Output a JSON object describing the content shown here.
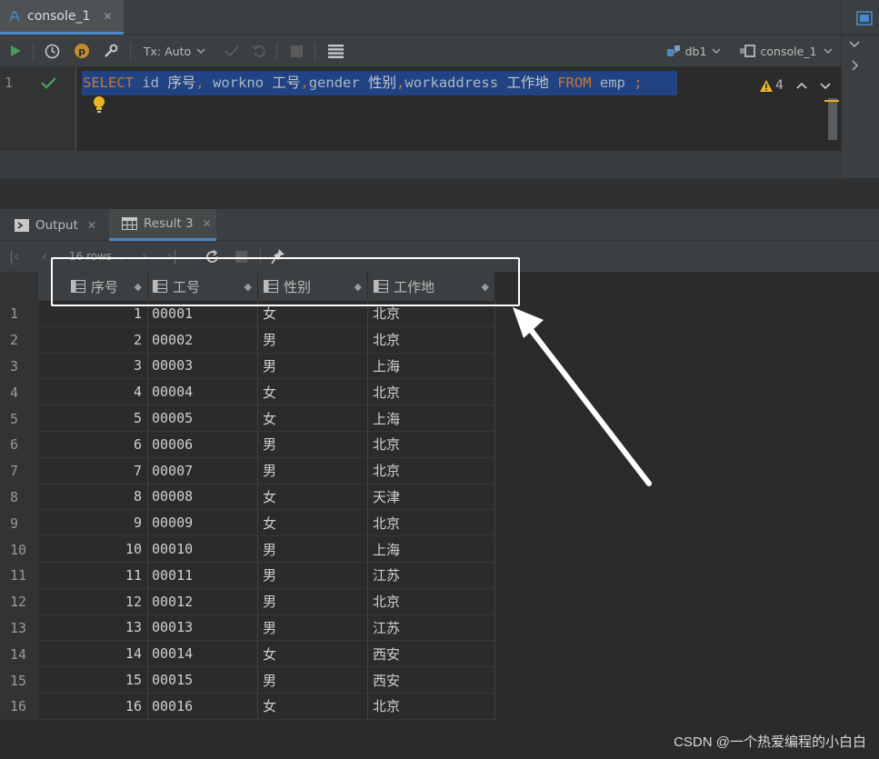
{
  "editor_tab": {
    "label": "console_1",
    "close": "✕"
  },
  "toolbar": {
    "tx_mode": "Tx: Auto",
    "datasource": "db1",
    "session": "console_1"
  },
  "editor": {
    "line_number": "1",
    "sql": {
      "select": "SELECT",
      "col1": " id ",
      "alias1": "序号",
      "comma1": ", ",
      "col2": "workno ",
      "alias2": "工号",
      "comma2": ",",
      "col3": "gender ",
      "alias3": "性别",
      "comma3": ",",
      "col4": "workaddress ",
      "alias4": "工作地",
      "from": " FROM ",
      "table": "emp ",
      "semi": ";"
    },
    "warnings_count": "4"
  },
  "panel_tabs": [
    {
      "label": "Output"
    },
    {
      "label": "Result 3"
    }
  ],
  "result_toolbar": {
    "rows_label": "16 rows"
  },
  "columns": [
    "序号",
    "工号",
    "性别",
    "工作地"
  ],
  "rows": [
    {
      "n": "1",
      "id": "1",
      "workno": "00001",
      "gender": "女",
      "addr": "北京"
    },
    {
      "n": "2",
      "id": "2",
      "workno": "00002",
      "gender": "男",
      "addr": "北京"
    },
    {
      "n": "3",
      "id": "3",
      "workno": "00003",
      "gender": "男",
      "addr": "上海"
    },
    {
      "n": "4",
      "id": "4",
      "workno": "00004",
      "gender": "女",
      "addr": "北京"
    },
    {
      "n": "5",
      "id": "5",
      "workno": "00005",
      "gender": "女",
      "addr": "上海"
    },
    {
      "n": "6",
      "id": "6",
      "workno": "00006",
      "gender": "男",
      "addr": "北京"
    },
    {
      "n": "7",
      "id": "7",
      "workno": "00007",
      "gender": "男",
      "addr": "北京"
    },
    {
      "n": "8",
      "id": "8",
      "workno": "00008",
      "gender": "女",
      "addr": "天津"
    },
    {
      "n": "9",
      "id": "9",
      "workno": "00009",
      "gender": "女",
      "addr": "北京"
    },
    {
      "n": "10",
      "id": "10",
      "workno": "00010",
      "gender": "男",
      "addr": "上海"
    },
    {
      "n": "11",
      "id": "11",
      "workno": "00011",
      "gender": "男",
      "addr": "江苏"
    },
    {
      "n": "12",
      "id": "12",
      "workno": "00012",
      "gender": "男",
      "addr": "北京"
    },
    {
      "n": "13",
      "id": "13",
      "workno": "00013",
      "gender": "男",
      "addr": "江苏"
    },
    {
      "n": "14",
      "id": "14",
      "workno": "00014",
      "gender": "女",
      "addr": "西安"
    },
    {
      "n": "15",
      "id": "15",
      "workno": "00015",
      "gender": "男",
      "addr": "西安"
    },
    {
      "n": "16",
      "id": "16",
      "workno": "00016",
      "gender": "女",
      "addr": "北京"
    }
  ],
  "watermark": "CSDN @一个热爱编程的小白白",
  "colors": {
    "accent": "#4a88c7",
    "run_green": "#499c54",
    "sql_keyword": "#cc7832",
    "selection": "#214283"
  }
}
